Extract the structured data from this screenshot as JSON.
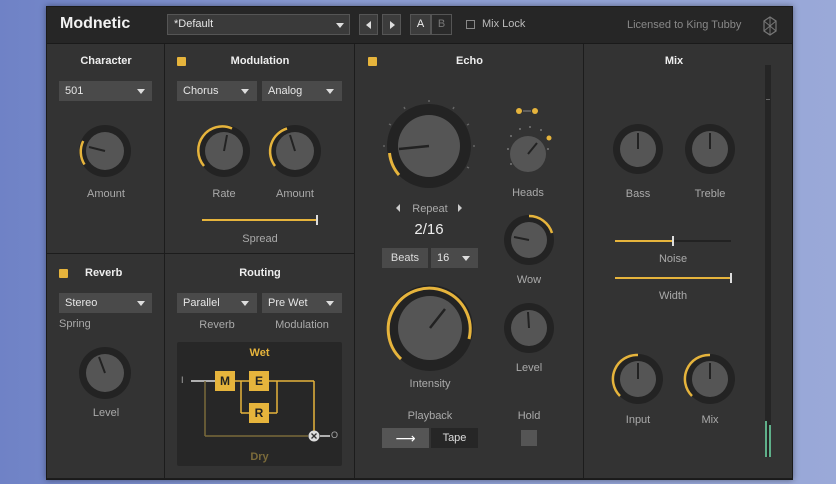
{
  "header": {
    "logo": "Modnetic",
    "preset": "*Default",
    "ab_a": "A",
    "ab_b": "B",
    "mix_lock": "Mix Lock",
    "license": "Licensed to King Tubby"
  },
  "character": {
    "title": "Character",
    "model": "501",
    "amount_label": "Amount"
  },
  "modulation": {
    "title": "Modulation",
    "type": "Chorus",
    "mode": "Analog",
    "rate_label": "Rate",
    "amount_label": "Amount",
    "spread_label": "Spread"
  },
  "reverb": {
    "title": "Reverb",
    "type": "Stereo",
    "type_label": "Spring",
    "level_label": "Level"
  },
  "routing": {
    "title": "Routing",
    "order": "Parallel",
    "order_label": "Reverb",
    "modulation_pos": "Pre Wet",
    "modulation_label": "Modulation",
    "wet_label": "Wet",
    "dry_label": "Dry",
    "box_m": "M",
    "box_e": "E",
    "box_r": "R",
    "in_mark": "I",
    "out_mark": "O"
  },
  "echo": {
    "title": "Echo",
    "repeat_label": "Repeat",
    "repeat_value": "2/16",
    "sync": "Beats",
    "division": "16",
    "heads_label": "Heads",
    "wow_label": "Wow",
    "intensity_label": "Intensity",
    "level_label": "Level",
    "playback_label": "Playback",
    "playback_arrow": "⟶",
    "playback_tape": "Tape",
    "hold_label": "Hold"
  },
  "mix": {
    "title": "Mix",
    "bass_label": "Bass",
    "treble_label": "Treble",
    "noise_label": "Noise",
    "width_label": "Width",
    "input_label": "Input",
    "mix_label": "Mix"
  },
  "colors": {
    "accent": "#e6b43c",
    "panel": "#333333",
    "knob": "#555555"
  }
}
